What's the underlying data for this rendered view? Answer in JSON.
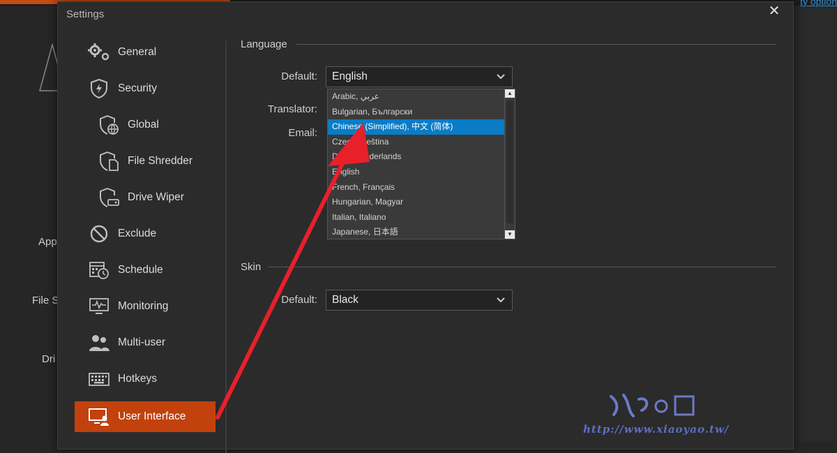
{
  "background": {
    "link_text": "ty option",
    "labels": [
      "App",
      "File S",
      "Dri"
    ]
  },
  "dialog": {
    "title": "Settings",
    "close": "✕"
  },
  "sidebar": {
    "items": [
      {
        "label": "General",
        "icon": "gear-icon"
      },
      {
        "label": "Security",
        "icon": "shield-icon"
      },
      {
        "label": "Global",
        "icon": "globe-shield-icon"
      },
      {
        "label": "File Shredder",
        "icon": "file-shield-icon"
      },
      {
        "label": "Drive Wiper",
        "icon": "drive-shield-icon"
      },
      {
        "label": "Exclude",
        "icon": "prohibited-icon"
      },
      {
        "label": "Schedule",
        "icon": "calendar-clock-icon"
      },
      {
        "label": "Monitoring",
        "icon": "monitor-pulse-icon"
      },
      {
        "label": "Multi-user",
        "icon": "users-icon"
      },
      {
        "label": "Hotkeys",
        "icon": "keyboard-icon"
      },
      {
        "label": "User Interface",
        "icon": "monitor-user-icon",
        "active": true
      }
    ]
  },
  "language": {
    "section_title": "Language",
    "default_label": "Default:",
    "default_value": "English",
    "translator_label": "Translator:",
    "email_label": "Email:",
    "options": [
      "Arabic, عربي",
      "Bulgarian, Български",
      "Chinese (Simplified), 中文 (简体)",
      "Czech, Čeština",
      "Dutch, Nederlands",
      "English",
      "French, Français",
      "Hungarian, Magyar",
      "Italian, Italiano",
      "Japanese, 日本語"
    ],
    "selected_option": "Chinese (Simplified), 中文 (简体)"
  },
  "skin": {
    "section_title": "Skin",
    "default_label": "Default:",
    "default_value": "Black"
  },
  "watermark": {
    "url": "http://www.xiaoyao.tw/"
  },
  "colors": {
    "accent": "#c2410c",
    "selection": "#0a7cc6",
    "arrow": "#e8202a"
  }
}
